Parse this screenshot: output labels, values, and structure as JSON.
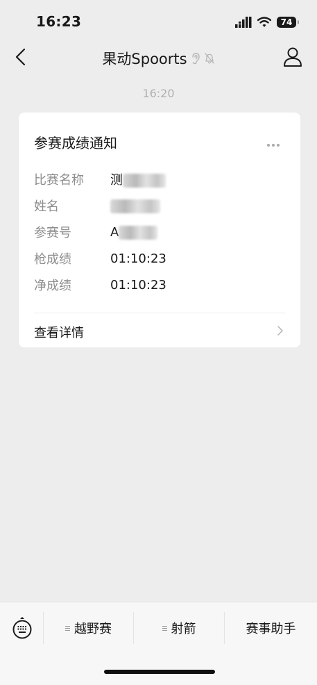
{
  "status_bar": {
    "time": "16:23",
    "battery": "74"
  },
  "nav": {
    "title": "果动Spoorts"
  },
  "chat": {
    "timestamp": "16:20"
  },
  "card": {
    "title": "参赛成绩通知",
    "fields": [
      {
        "label": "比赛名称",
        "value": "测"
      },
      {
        "label": "姓名",
        "value": ""
      },
      {
        "label": "参赛号",
        "value": "A"
      },
      {
        "label": "枪成绩",
        "value": "01:10:23"
      },
      {
        "label": "净成绩",
        "value": "01:10:23"
      }
    ],
    "detail_label": "查看详情"
  },
  "bottom_menu": {
    "items": [
      {
        "label": "越野赛"
      },
      {
        "label": "射箭"
      },
      {
        "label": "赛事助手"
      }
    ]
  },
  "icons": {
    "back": "chevron-left-icon",
    "profile": "person-icon",
    "ear": "ear-icon",
    "mute": "bell-off-icon",
    "more": "more-icon",
    "detail": "chevron-right-icon",
    "keyboard": "keyboard-icon"
  }
}
